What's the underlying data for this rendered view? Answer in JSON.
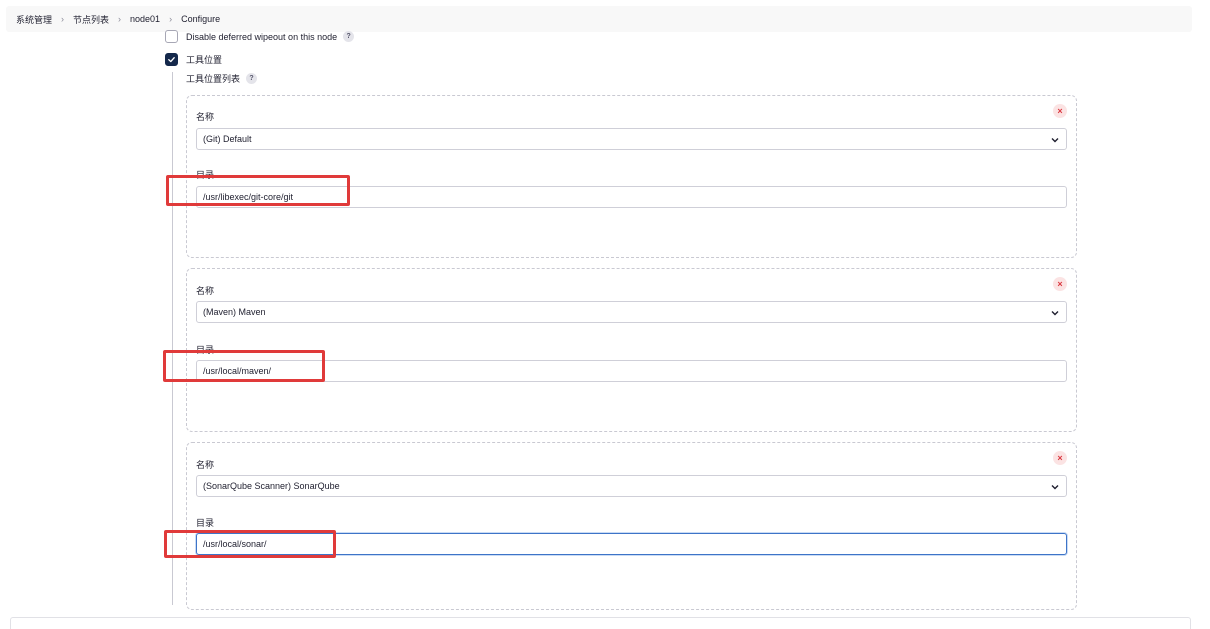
{
  "breadcrumb": [
    "系统管理",
    "节点列表",
    "node01",
    "Configure"
  ],
  "options": {
    "disable_wipeout": {
      "label": "Disable deferred wipeout on this node",
      "checked": false,
      "help": "?"
    },
    "tool_location": {
      "label": "工具位置",
      "checked": true
    }
  },
  "tool_list": {
    "label": "工具位置列表",
    "help": "?"
  },
  "cards": [
    {
      "name_label": "名称",
      "name_value": "(Git) Default",
      "dir_label": "目录",
      "dir_value": "/usr/libexec/git-core/git",
      "close": "×"
    },
    {
      "name_label": "名称",
      "name_value": "(Maven) Maven",
      "dir_label": "目录",
      "dir_value": "/usr/local/maven/",
      "close": "×"
    },
    {
      "name_label": "名称",
      "name_value": "(SonarQube Scanner) SonarQube",
      "dir_label": "目录",
      "dir_value": "/usr/local/sonar/",
      "close": "×"
    }
  ],
  "colors": {
    "accent": "#14284b",
    "highlight": "#e03a3a",
    "delete": "#d9363e",
    "focus": "#3e74c8"
  }
}
